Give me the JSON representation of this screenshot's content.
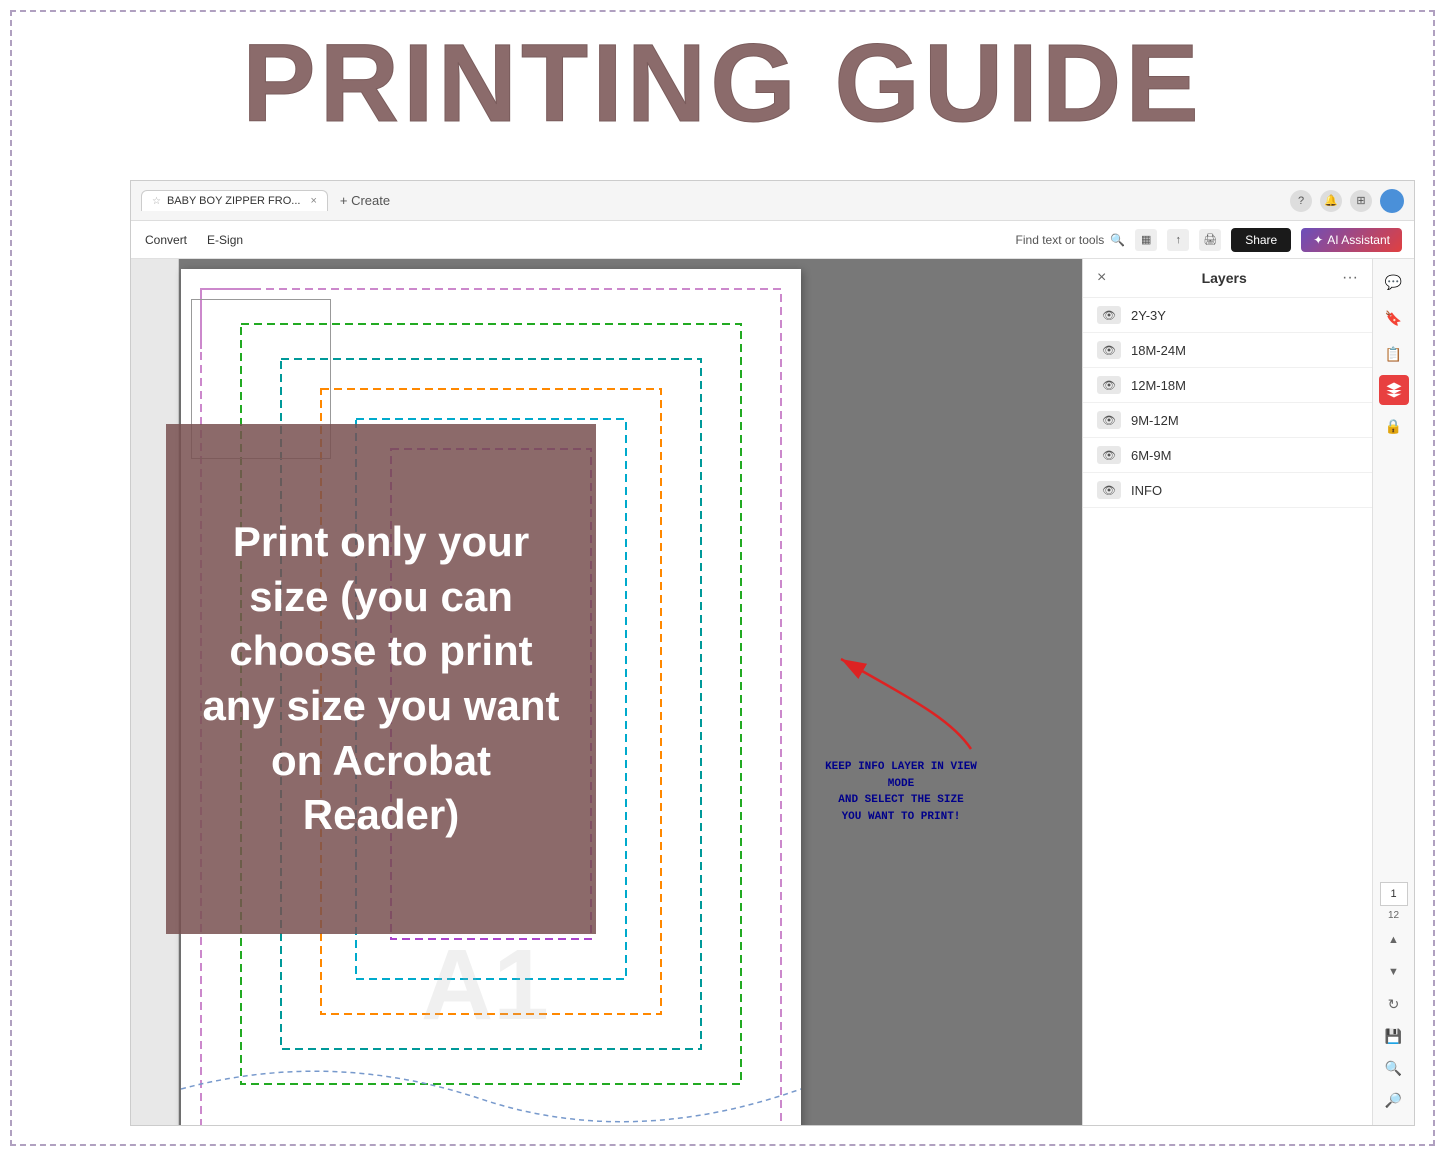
{
  "page": {
    "title": "PRINTING GUIDE",
    "outer_border_color": "#b0a0c0",
    "title_color": "#8b6b6b"
  },
  "browser": {
    "tab_label": "BABY BOY ZIPPER FRO...",
    "tab_new_label": "+ Create",
    "icons": {
      "help": "?",
      "bell": "🔔",
      "grid": "⊞"
    }
  },
  "toolbar": {
    "convert_label": "Convert",
    "esign_label": "E-Sign",
    "search_placeholder": "Find text or tools",
    "share_label": "Share",
    "ai_label": "AI Assistant"
  },
  "layers_panel": {
    "title": "Layers",
    "close_icon": "×",
    "more_icon": "···",
    "layers": [
      {
        "name": "2Y-3Y",
        "visible": true
      },
      {
        "name": "18M-24M",
        "visible": true
      },
      {
        "name": "12M-18M",
        "visible": true
      },
      {
        "name": "9M-12M",
        "visible": true
      },
      {
        "name": "6M-9M",
        "visible": true
      },
      {
        "name": "INFO",
        "visible": true
      }
    ]
  },
  "overlay": {
    "text": "Print only your size (you can choose to print any size you want on Acrobat Reader)"
  },
  "annotation": {
    "text": "KEEP INFO LAYER IN VIEW MODE\nAND SELECT THE SIZE\nYOU WANT TO PRINT!"
  },
  "page_controls": {
    "current": "1",
    "total": "12"
  },
  "right_sidebar": {
    "icons": [
      "comment",
      "bookmark",
      "copy",
      "layers",
      "lock"
    ]
  },
  "dashed_lines": {
    "colors": [
      "#cc88cc",
      "#008800",
      "#009999",
      "#ff8800",
      "#00aacc",
      "#aa44cc"
    ]
  }
}
